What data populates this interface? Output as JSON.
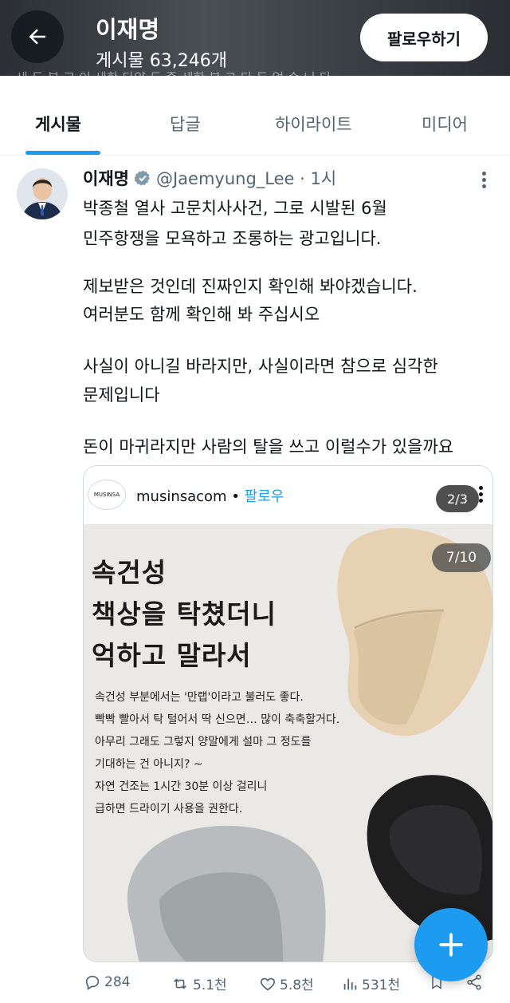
{
  "header": {
    "title": "이재명",
    "post_count": "게시물 63,246개",
    "follow_label": "팔로우하기",
    "ghost_text": "세 두 분 고 이 세한 다양 두 중 세한 분 그 다 두 없 습 니 다"
  },
  "tabs": [
    {
      "label": "게시물",
      "active": true
    },
    {
      "label": "답글",
      "active": false
    },
    {
      "label": "하이라이트",
      "active": false
    },
    {
      "label": "미디어",
      "active": false
    }
  ],
  "tweet": {
    "name": "이재명",
    "handle": "@Jaemyung_Lee · 1시",
    "lines": [
      "박종철 열사 고문치사사건, 그로 시발된 6월",
      "민주항쟁을 모욕하고 조롱하는 광고입니다.",
      "제보받은 것인데 진짜인지 확인해 봐야겠습니다.",
      "여러분도 함께 확인해 봐 주십시오",
      "사실이 아니길 바라지만, 사실이라면 참으로 심각한",
      "문제입니다",
      "돈이 마귀라지만 사람의 탈을 쓰고 이럴수가 있을까요"
    ]
  },
  "embed": {
    "logo_text": "MUSINSA",
    "account": "musinsacom",
    "follow": "팔로우",
    "count": "2/3",
    "page": "7/10",
    "headline": [
      "속건성",
      "책상을 탁쳤더니",
      "억하고 말라서"
    ],
    "body": [
      "속건성 부분에서는 '만랩'이라고 불러도 좋다.",
      "빡빡 빨아서 탁 털어서 딱 신으면… 많이 축축할거다.",
      "아무리 그래도 그렇지 양말에게 설마 그 정도를",
      "기대하는 건 아니지? ~",
      "자연 건조는 1시간 30분 이상 걸리니",
      "급하면 드라이기 사용을 권한다."
    ]
  },
  "actions": {
    "replies": "284",
    "reposts": "5.1천",
    "likes": "5.8천",
    "views": "531천"
  },
  "colors": {
    "accent": "#1d9bf0",
    "text": "#0f1419",
    "muted": "#536471"
  }
}
